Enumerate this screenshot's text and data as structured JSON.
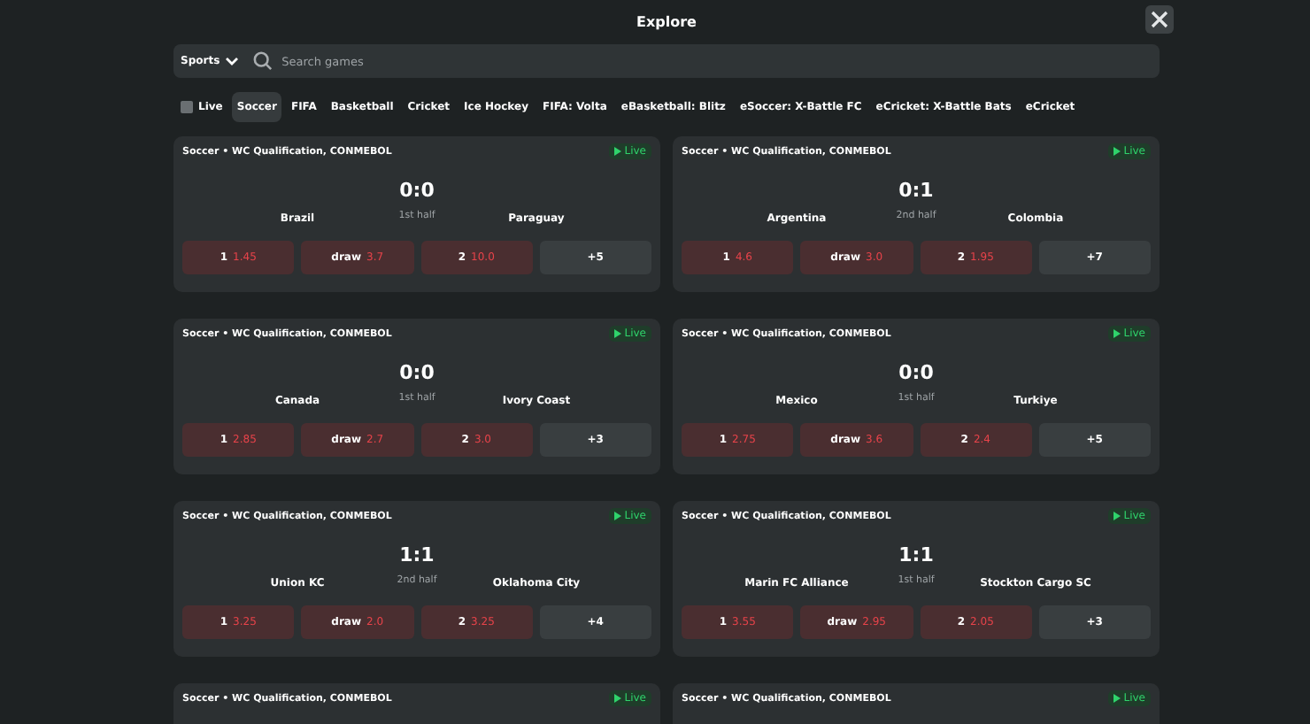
{
  "header": {
    "title": "Explore"
  },
  "search": {
    "category": "Sports",
    "placeholder": "Search games"
  },
  "live_filter": {
    "label": "Live",
    "checked": false
  },
  "tabs": [
    {
      "label": "Soccer",
      "selected": true
    },
    {
      "label": "FIFA",
      "selected": false
    },
    {
      "label": "Basketball",
      "selected": false
    },
    {
      "label": "Cricket",
      "selected": false
    },
    {
      "label": "Ice Hockey",
      "selected": false
    },
    {
      "label": "FIFA: Volta",
      "selected": false
    },
    {
      "label": "eBasketball: Blitz",
      "selected": false
    },
    {
      "label": "eSoccer: X-Battle FC",
      "selected": false
    },
    {
      "label": "eCricket: X-Battle Bats",
      "selected": false
    },
    {
      "label": "eCricket",
      "selected": false
    }
  ],
  "matches": [
    {
      "league": "Soccer • WC Qualification, CONMEBOL",
      "live": "Live",
      "score": "0:0",
      "period": "1st half",
      "home": "Brazil",
      "away": "Paraguay",
      "odds": [
        {
          "label": "1",
          "value": "1.45"
        },
        {
          "label": "draw",
          "value": "3.7"
        },
        {
          "label": "2",
          "value": "10.0"
        }
      ],
      "more": "+5"
    },
    {
      "league": "Soccer • WC Qualification, CONMEBOL",
      "live": "Live",
      "score": "0:1",
      "period": "2nd half",
      "home": "Argentina",
      "away": "Colombia",
      "odds": [
        {
          "label": "1",
          "value": "4.6"
        },
        {
          "label": "draw",
          "value": "3.0"
        },
        {
          "label": "2",
          "value": "1.95"
        }
      ],
      "more": "+7"
    },
    {
      "league": "Soccer • WC Qualification, CONMEBOL",
      "live": "Live",
      "score": "0:0",
      "period": "1st half",
      "home": "Canada",
      "away": "Ivory Coast",
      "odds": [
        {
          "label": "1",
          "value": "2.85"
        },
        {
          "label": "draw",
          "value": "2.7"
        },
        {
          "label": "2",
          "value": "3.0"
        }
      ],
      "more": "+3"
    },
    {
      "league": "Soccer • WC Qualification, CONMEBOL",
      "live": "Live",
      "score": "0:0",
      "period": "1st half",
      "home": "Mexico",
      "away": "Turkiye",
      "odds": [
        {
          "label": "1",
          "value": "2.75"
        },
        {
          "label": "draw",
          "value": "3.6"
        },
        {
          "label": "2",
          "value": "2.4"
        }
      ],
      "more": "+5"
    },
    {
      "league": "Soccer • WC Qualification, CONMEBOL",
      "live": "Live",
      "score": "1:1",
      "period": "2nd half",
      "home": "Union KC",
      "away": "Oklahoma City",
      "odds": [
        {
          "label": "1",
          "value": "3.25"
        },
        {
          "label": "draw",
          "value": "2.0"
        },
        {
          "label": "2",
          "value": "3.25"
        }
      ],
      "more": "+4"
    },
    {
      "league": "Soccer • WC Qualification, CONMEBOL",
      "live": "Live",
      "score": "1:1",
      "period": "1st half",
      "home": "Marin FC Alliance",
      "away": "Stockton Cargo SC",
      "odds": [
        {
          "label": "1",
          "value": "3.55"
        },
        {
          "label": "draw",
          "value": "2.95"
        },
        {
          "label": "2",
          "value": "2.05"
        }
      ],
      "more": "+3"
    },
    {
      "league": "Soccer • WC Qualification, CONMEBOL",
      "live": "Live"
    },
    {
      "league": "Soccer • WC Qualification, CONMEBOL",
      "live": "Live"
    }
  ]
}
